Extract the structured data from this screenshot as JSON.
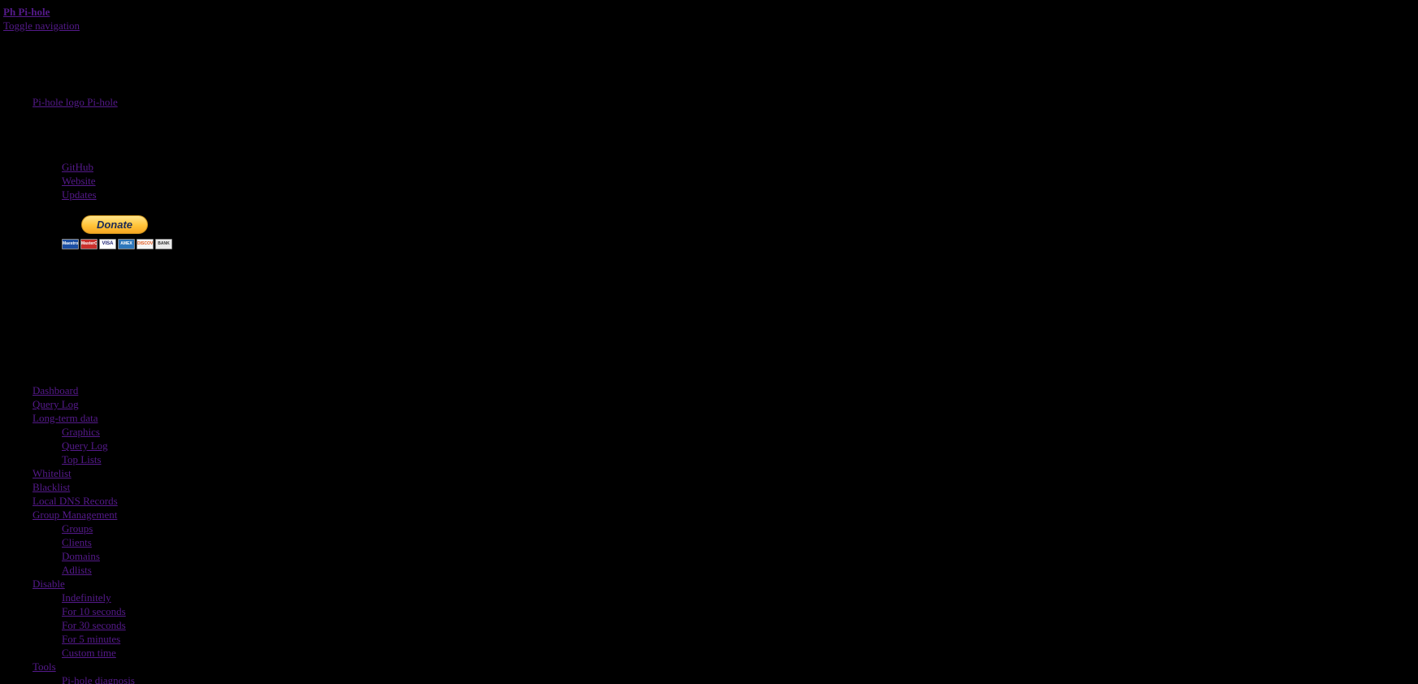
{
  "header": {
    "brand_mini": "Ph",
    "brand_large": "Pi-hole",
    "toggle_label": "Toggle navigation"
  },
  "sidebar": {
    "logo_link": "Pi-hole logo Pi-hole",
    "external_links": [
      "GitHub",
      "Website",
      "Updates"
    ],
    "donate_label": "Donate",
    "payment_cards": [
      "Maestro",
      "MasterCard",
      "VISA",
      "AMEX",
      "DISCOVER",
      "BANK"
    ],
    "menu": {
      "dashboard": "Dashboard",
      "query_log": "Query Log",
      "long_term": "Long-term data",
      "long_term_items": [
        "Graphics",
        "Query Log",
        "Top Lists"
      ],
      "whitelist": "Whitelist",
      "blacklist": "Blacklist",
      "local_dns": "Local DNS Records",
      "group_mgmt": "Group Management",
      "group_items": [
        "Groups",
        "Clients",
        "Domains",
        "Adlists"
      ],
      "disable": "Disable",
      "disable_items": [
        "Indefinitely",
        "For 10 seconds",
        "For 30 seconds",
        "For 5 minutes",
        "Custom time"
      ],
      "tools": "Tools",
      "tools_items": [
        "Pi-hole diagnosis"
      ]
    }
  },
  "colors": {
    "background": "#000000",
    "link_visited": "#551a8b"
  }
}
